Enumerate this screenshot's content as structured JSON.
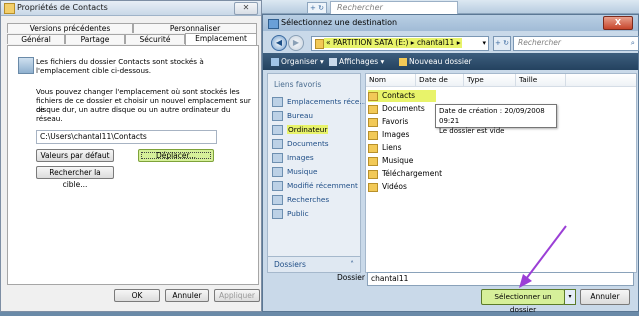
{
  "background_window": {
    "nav_button": "+ ↻",
    "search_placeholder": "Rechercher"
  },
  "properties_window": {
    "title": "Propriétés de Contacts",
    "close_glyph": "✕",
    "tabs_row1": [
      "Versions précédentes",
      "Personnaliser"
    ],
    "tabs_row2": [
      "Général",
      "Partage",
      "Sécurité",
      "Emplacement"
    ],
    "active_tab": "Emplacement",
    "intro_line1": "Les fichiers du dossier Contacts sont stockés à",
    "intro_line2": "l'emplacement cible ci-dessous.",
    "help_line1": "Vous pouvez changer l'emplacement où sont stockés les",
    "help_line2": "fichiers de ce dossier et choisir un nouvel emplacement sur ce",
    "help_line3": "disque dur, un autre disque ou un autre ordinateur du réseau.",
    "path_value": "C:\\Users\\chantal11\\Contacts",
    "btn_default": "Valeurs par défaut",
    "btn_move": "Déplacer...",
    "btn_find_target": "Rechercher la cible...",
    "btn_ok": "OK",
    "btn_cancel": "Annuler",
    "btn_apply": "Appliquer"
  },
  "dialog": {
    "title": "Sélectionnez une destination",
    "close_glyph": "X",
    "back_glyph": "◀",
    "forward_glyph": "▶",
    "address_prefix": "«",
    "address_drive": "PARTITION SATA (E:)",
    "address_sep": "▸",
    "address_folder": "chantal11",
    "address_dropdown": "▾",
    "refresh_glyph": "+ ↻",
    "search_placeholder": "Rechercher",
    "search_icon": "⌕",
    "toolbar": {
      "organize": "Organiser ▾",
      "views": "Affichages ▾",
      "new_folder": "Nouveau dossier"
    },
    "sidebar": {
      "header": "Liens favoris",
      "items": [
        "Emplacements réce...",
        "Bureau",
        "Ordinateur",
        "Documents",
        "Images",
        "Musique",
        "Modifié récemment",
        "Recherches",
        "Public"
      ],
      "highlighted": "Ordinateur",
      "footer": "Dossiers",
      "footer_arrow": "˄"
    },
    "columns": [
      "Nom",
      "Date de m...",
      "Type",
      "Taille"
    ],
    "files": [
      "Contacts",
      "Documents",
      "Favoris",
      "Images",
      "Liens",
      "Musique",
      "Téléchargement",
      "Vidéos"
    ],
    "selected_file": "Contacts",
    "tooltip_line1": "Date de création : 20/09/2008 09:21",
    "tooltip_line2": "Le dossier est vide",
    "folder_label": "Dossier :",
    "folder_value": "chantal11",
    "btn_select": "Sélectionner un dossier",
    "btn_select_dropdown": "▾",
    "btn_cancel": "Annuler"
  },
  "colors": {
    "highlight": "#e8f36a",
    "green_button": "#d6f09a",
    "annotation_arrow": "#9b3fd6",
    "toolbar_bg": "#2d4c6b"
  }
}
